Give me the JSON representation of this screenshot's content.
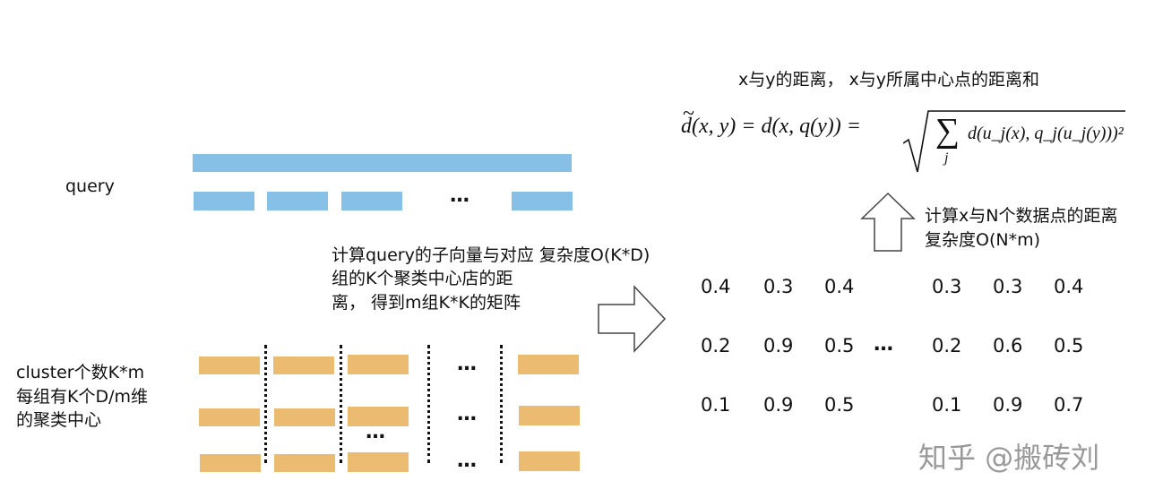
{
  "top_caption": "x与y的距离， x与y所属中心点的距离和",
  "formula": {
    "lhs": "d(x, y) = d(x, q(y)) =",
    "sum": "∑",
    "index": "j",
    "rhs": "d(u_j(x), q_j(u_j(y)))²"
  },
  "query_label": "query",
  "ellipsis": "…",
  "middle_text": [
    "计算query的子向量与对应  复杂度O(K*D)",
    "组的K个聚类中心店的距",
    "离， 得到m组K*K的矩阵"
  ],
  "cluster_text": [
    "cluster个数K*m",
    "每组有K个D/m维",
    "的聚类中心"
  ],
  "right_text": [
    "计算x与N个数据点的距离",
    "复杂度O(N*m)"
  ],
  "matrix_left": [
    [
      "0.4",
      "0.3",
      "0.4"
    ],
    [
      "0.2",
      "0.9",
      "0.5"
    ],
    [
      "0.1",
      "0.9",
      "0.5"
    ]
  ],
  "matrix_right": [
    [
      "0.3",
      "0.3",
      "0.4"
    ],
    [
      "0.2",
      "0.6",
      "0.5"
    ],
    [
      "0.1",
      "0.9",
      "0.7"
    ]
  ],
  "watermark": "知乎 @搬砖刘",
  "colors": {
    "query": "#86c0e6",
    "cluster": "#ecbb72"
  }
}
